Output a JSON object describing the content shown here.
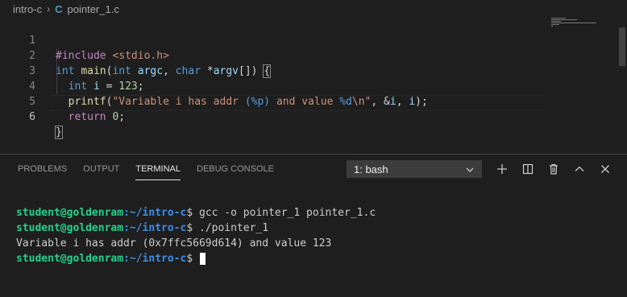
{
  "breadcrumb": {
    "folder": "intro-c",
    "file_icon": "C",
    "file": "pointer_1.c",
    "separator": "›"
  },
  "editor": {
    "line_numbers": [
      "1",
      "2",
      "3",
      "4",
      "5",
      "6"
    ],
    "lines": [
      "#include <stdio.h>",
      "int main(int argc, char *argv[]) {",
      "  int i = 123;",
      "  printf(\"Variable i has addr (%p) and value %d\\n\", &i, i);",
      "  return 0;",
      "}"
    ]
  },
  "panel": {
    "tabs": [
      "PROBLEMS",
      "OUTPUT",
      "TERMINAL",
      "DEBUG CONSOLE"
    ],
    "active_tab": "TERMINAL",
    "terminal_select": "1: bash",
    "actions": [
      "plus-icon",
      "split-icon",
      "trash-icon",
      "chevron-up-icon",
      "close-icon"
    ]
  },
  "terminal": {
    "user_host": "student@goldenram",
    "path": ":~/intro-c",
    "lines": [
      {
        "prompt": true,
        "cmd": " gcc -o pointer_1 pointer_1.c"
      },
      {
        "prompt": true,
        "cmd": " ./pointer_1"
      },
      {
        "prompt": false,
        "text": "Variable i has addr (0x7ffc5669d614) and value 123"
      },
      {
        "prompt": true,
        "cmd": " "
      }
    ],
    "dollar": "$"
  },
  "colors": {
    "background": "#1e1e1e",
    "prompt_user": "#23d18b",
    "prompt_path": "#3b8eea"
  }
}
